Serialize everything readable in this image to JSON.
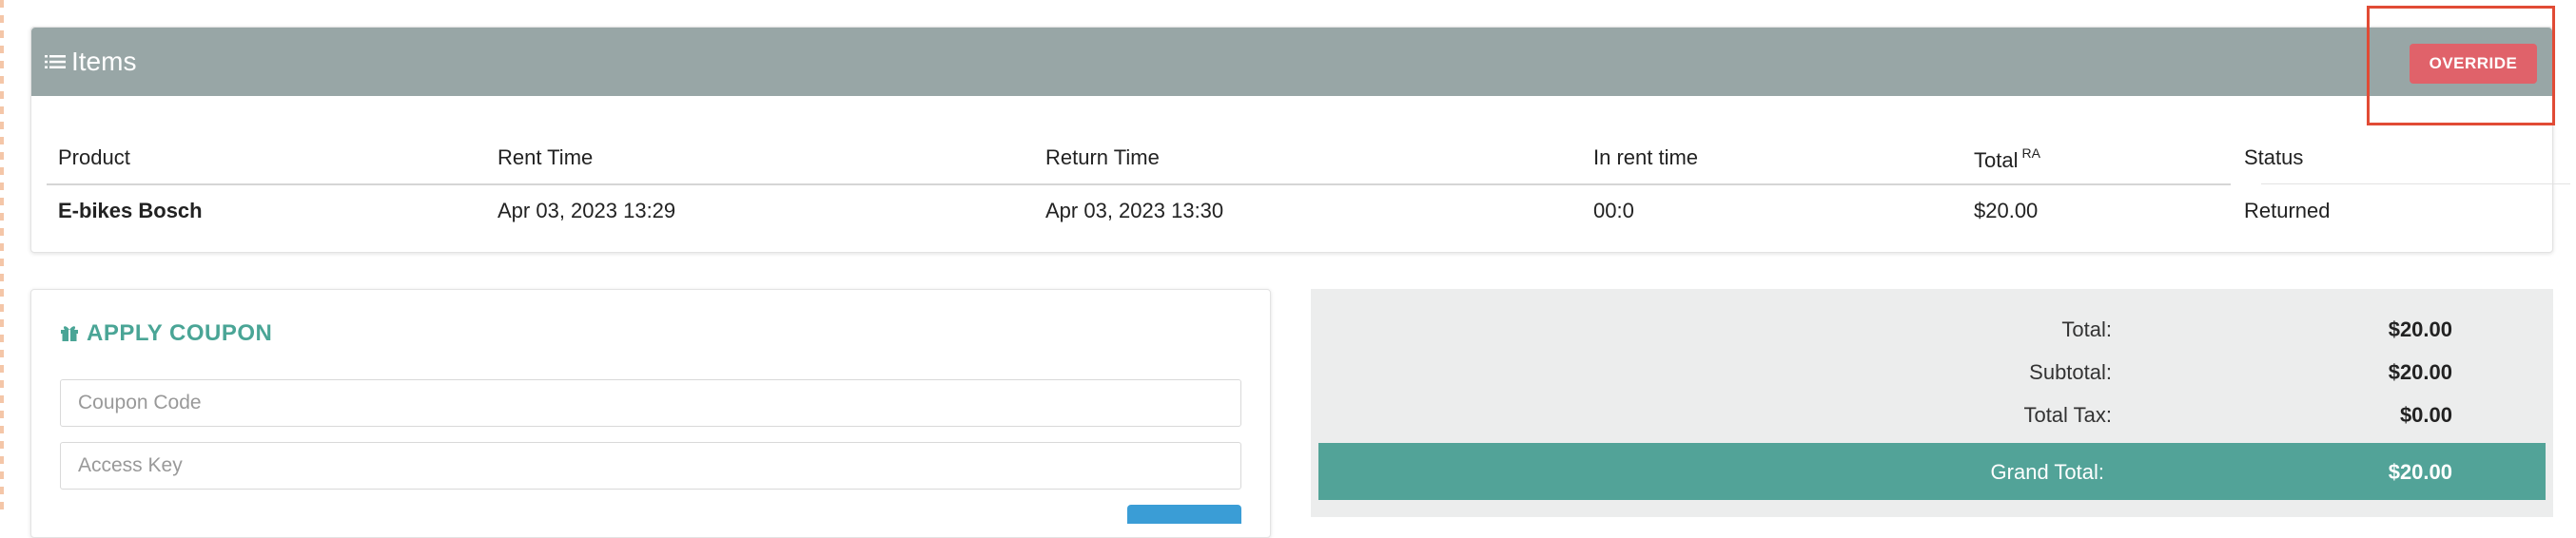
{
  "items": {
    "title": "Items",
    "override_label": "OVERRIDE",
    "columns": {
      "product": "Product",
      "rent_time": "Rent Time",
      "return_time": "Return Time",
      "in_rent_time": "In rent time",
      "total": "Total",
      "total_sup": "RA",
      "status": "Status"
    },
    "rows": [
      {
        "product": "E-bikes Bosch",
        "rent_time": "Apr 03, 2023 13:29",
        "return_time": "Apr 03, 2023 13:30",
        "in_rent_time": "00:0",
        "total": "$20.00",
        "status": "Returned"
      }
    ]
  },
  "coupon": {
    "title": "APPLY COUPON",
    "coupon_placeholder": "Coupon Code",
    "access_key_placeholder": "Access Key"
  },
  "totals": {
    "total_label": "Total:",
    "total_value": "$20.00",
    "subtotal_label": "Subtotal:",
    "subtotal_value": "$20.00",
    "tax_label": "Total Tax:",
    "tax_value": "$0.00",
    "grand_label": "Grand Total:",
    "grand_value": "$20.00"
  },
  "colors": {
    "header_bg": "#98a6a6",
    "override_bg": "#e0626a",
    "highlight": "#e14b35",
    "accent": "#52a398"
  }
}
